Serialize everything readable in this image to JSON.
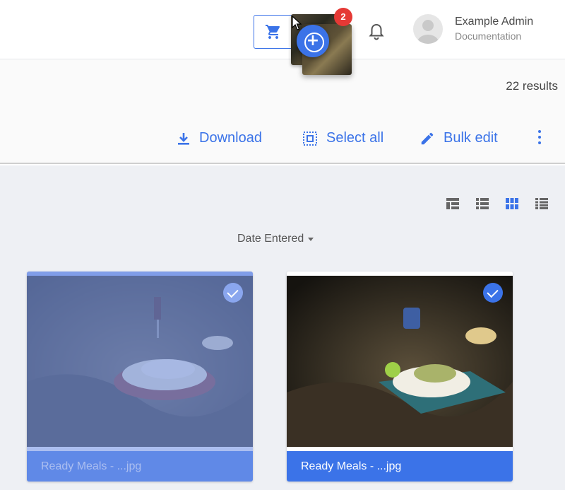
{
  "header": {
    "user_name": "Example Admin",
    "user_role": "Documentation",
    "cart_count": "2"
  },
  "toolbar": {
    "results": "22 results",
    "download_label": "Download",
    "select_all_label": "Select all",
    "bulk_edit_label": "Bulk edit"
  },
  "sort": {
    "label": "Date Entered"
  },
  "assets": [
    {
      "caption": "Ready Meals - ...jpg",
      "selected": true
    },
    {
      "caption": "Ready Meals - ...jpg",
      "selected": true
    }
  ],
  "colors": {
    "accent": "#3b73e8",
    "badge": "#e53935"
  },
  "icons": [
    "cart-icon",
    "bell-icon",
    "add-circle-icon",
    "download-icon",
    "select-all-icon",
    "pencil-icon",
    "more-vert-icon",
    "masonry-view-icon",
    "list-view-icon",
    "grid-view-icon",
    "detail-list-view-icon",
    "check-icon"
  ]
}
